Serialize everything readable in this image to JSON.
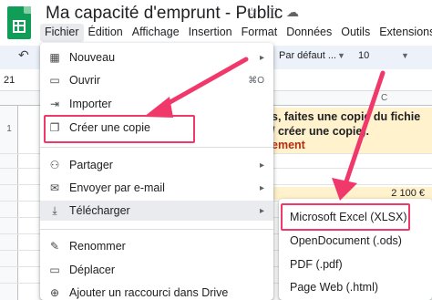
{
  "window": {
    "title": "Ma capacité d'emprunt - Public",
    "icons": [
      "star-icon",
      "move-to-folder-icon",
      "cloud-saved-icon"
    ]
  },
  "menubar": {
    "items": [
      "Fichier",
      "Édition",
      "Affichage",
      "Insertion",
      "Format",
      "Données",
      "Outils",
      "Extensions"
    ],
    "active": "Fichier"
  },
  "toolbar": {
    "font": "Par défaut ...",
    "font_size": "10"
  },
  "formula_bar": {
    "cell_ref": "21"
  },
  "sheet": {
    "column_label": "C",
    "row_number": "1",
    "banner_line1": "s, faites une copie du fichie",
    "banner_line2": "/ créer une copie).",
    "banner_line3": "ement",
    "amount": "2 100 €"
  },
  "file_menu": {
    "items": [
      {
        "label": "Nouveau",
        "icon": "new-doc-icon",
        "extra": "▸"
      },
      {
        "label": "Ouvrir",
        "icon": "folder-icon",
        "extra": "⌘O"
      },
      {
        "label": "Importer",
        "icon": "import-icon",
        "extra": ""
      },
      {
        "label": "Créer une copie",
        "icon": "copy-icon",
        "extra": ""
      },
      {
        "label": "Partager",
        "icon": "share-person-icon",
        "extra": "▸"
      },
      {
        "label": "Envoyer par e-mail",
        "icon": "email-icon",
        "extra": "▸"
      },
      {
        "label": "Télécharger",
        "icon": "download-icon",
        "extra": "▸"
      },
      {
        "label": "Renommer",
        "icon": "rename-icon",
        "extra": ""
      },
      {
        "label": "Déplacer",
        "icon": "move-folder-icon",
        "extra": ""
      },
      {
        "label": "Ajouter un raccourci dans Drive",
        "icon": "drive-shortcut-icon",
        "extra": ""
      }
    ],
    "hovered": "Télécharger"
  },
  "download_submenu": {
    "items": [
      "Microsoft Excel (XLSX)",
      "OpenDocument (.ods)",
      "PDF (.pdf)",
      "Page Web (.html)"
    ],
    "highlighted": "Microsoft Excel (XLSX)"
  },
  "annotation_color": "#f0386b"
}
